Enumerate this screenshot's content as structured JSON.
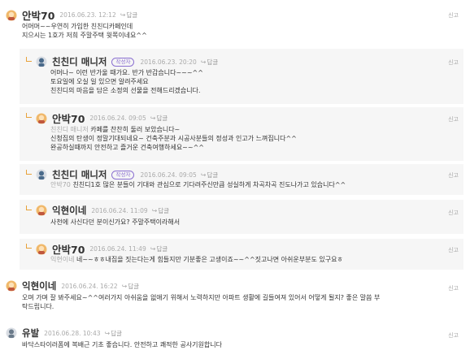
{
  "comments": [
    {
      "author": "안박70",
      "date": "2016.06.23. 12:12",
      "reply": "답글",
      "report": "신고",
      "lines": "어머머~~우연히 가입한 친친디카페인데\n지으시는 1호가 저희 주말주택 윗쪽이네요^^"
    },
    {
      "author": "친친디 매니저",
      "badge": "작성자",
      "date": "2016.06.23. 20:20",
      "reply": "답글",
      "report": "신고",
      "lines": "어머나~ 이런 반가울 때가요. 반가 반갑습니다~~~^^\n토요일에 오실 일 있으면 알려주세요\n친친디의 마음을 담은 소정의 선물을 전해드리겠습니다."
    },
    {
      "author": "안박70",
      "date": "2016.06.24. 09:05",
      "reply": "답글",
      "report": "신고",
      "mention": "친친디 매니저",
      "first": " 카페를 찬찬히 둘러 보았습니다~",
      "lines": "신청집의 탄생이 정말기대되네요~ 건축주분과 시공사분들의 정성과 인고가 느껴집니다^^\n완공하실때까지 안전하고 즐거운 건축여행하세요~~^^"
    },
    {
      "author": "친친디 매니저",
      "badge": "작성자",
      "date": "2016.06.24. 09:05",
      "reply": "답글",
      "report": "신고",
      "mention": "안박70",
      "first": " 친친디1호 많은 분들이 기대와 관심으로 기다려주신만큼 성실하게 차곡차곡 진도나가고 있습니다^^"
    },
    {
      "author": "익현이네",
      "date": "2016.06.24. 11:09",
      "reply": "답글",
      "report": "신고",
      "lines": "사천에 사신다던 분이신가요? 주말주택이라해서"
    },
    {
      "author": "안박70",
      "date": "2016.06.24. 11:49",
      "reply": "답글",
      "report": "신고",
      "mention": "익현이네",
      "first": " 네~~ㅎㅎ내집을 짓는다는게 힘들지만 기분좋은 고생이죠~~^^짓고나면 아쉬운부분도 있구요ㅎ"
    },
    {
      "author": "익현이네",
      "date": "2016.06.24. 16:22",
      "reply": "답글",
      "report": "신고",
      "lines": "오며 가며 잘 봐주세요~^^여러가지 아쉬움을 없애기 위해서 노력하지만 아파트 생활에 길들여져 있어서 어떻게 될지? 좋은 말씀 부\n탁드립니다."
    },
    {
      "author": "유발",
      "date": "2016.06.28. 10:43",
      "reply": "답글",
      "report": "신고",
      "lines": "바닥스타이러폼에 복배근 기초 좋습니다. 안전하고 쾌적한 공사기원합니다"
    }
  ],
  "colors": {
    "accent": "#8a6fd0",
    "reply_bg": "#f6f6f6",
    "muted": "#aaaaaa"
  }
}
